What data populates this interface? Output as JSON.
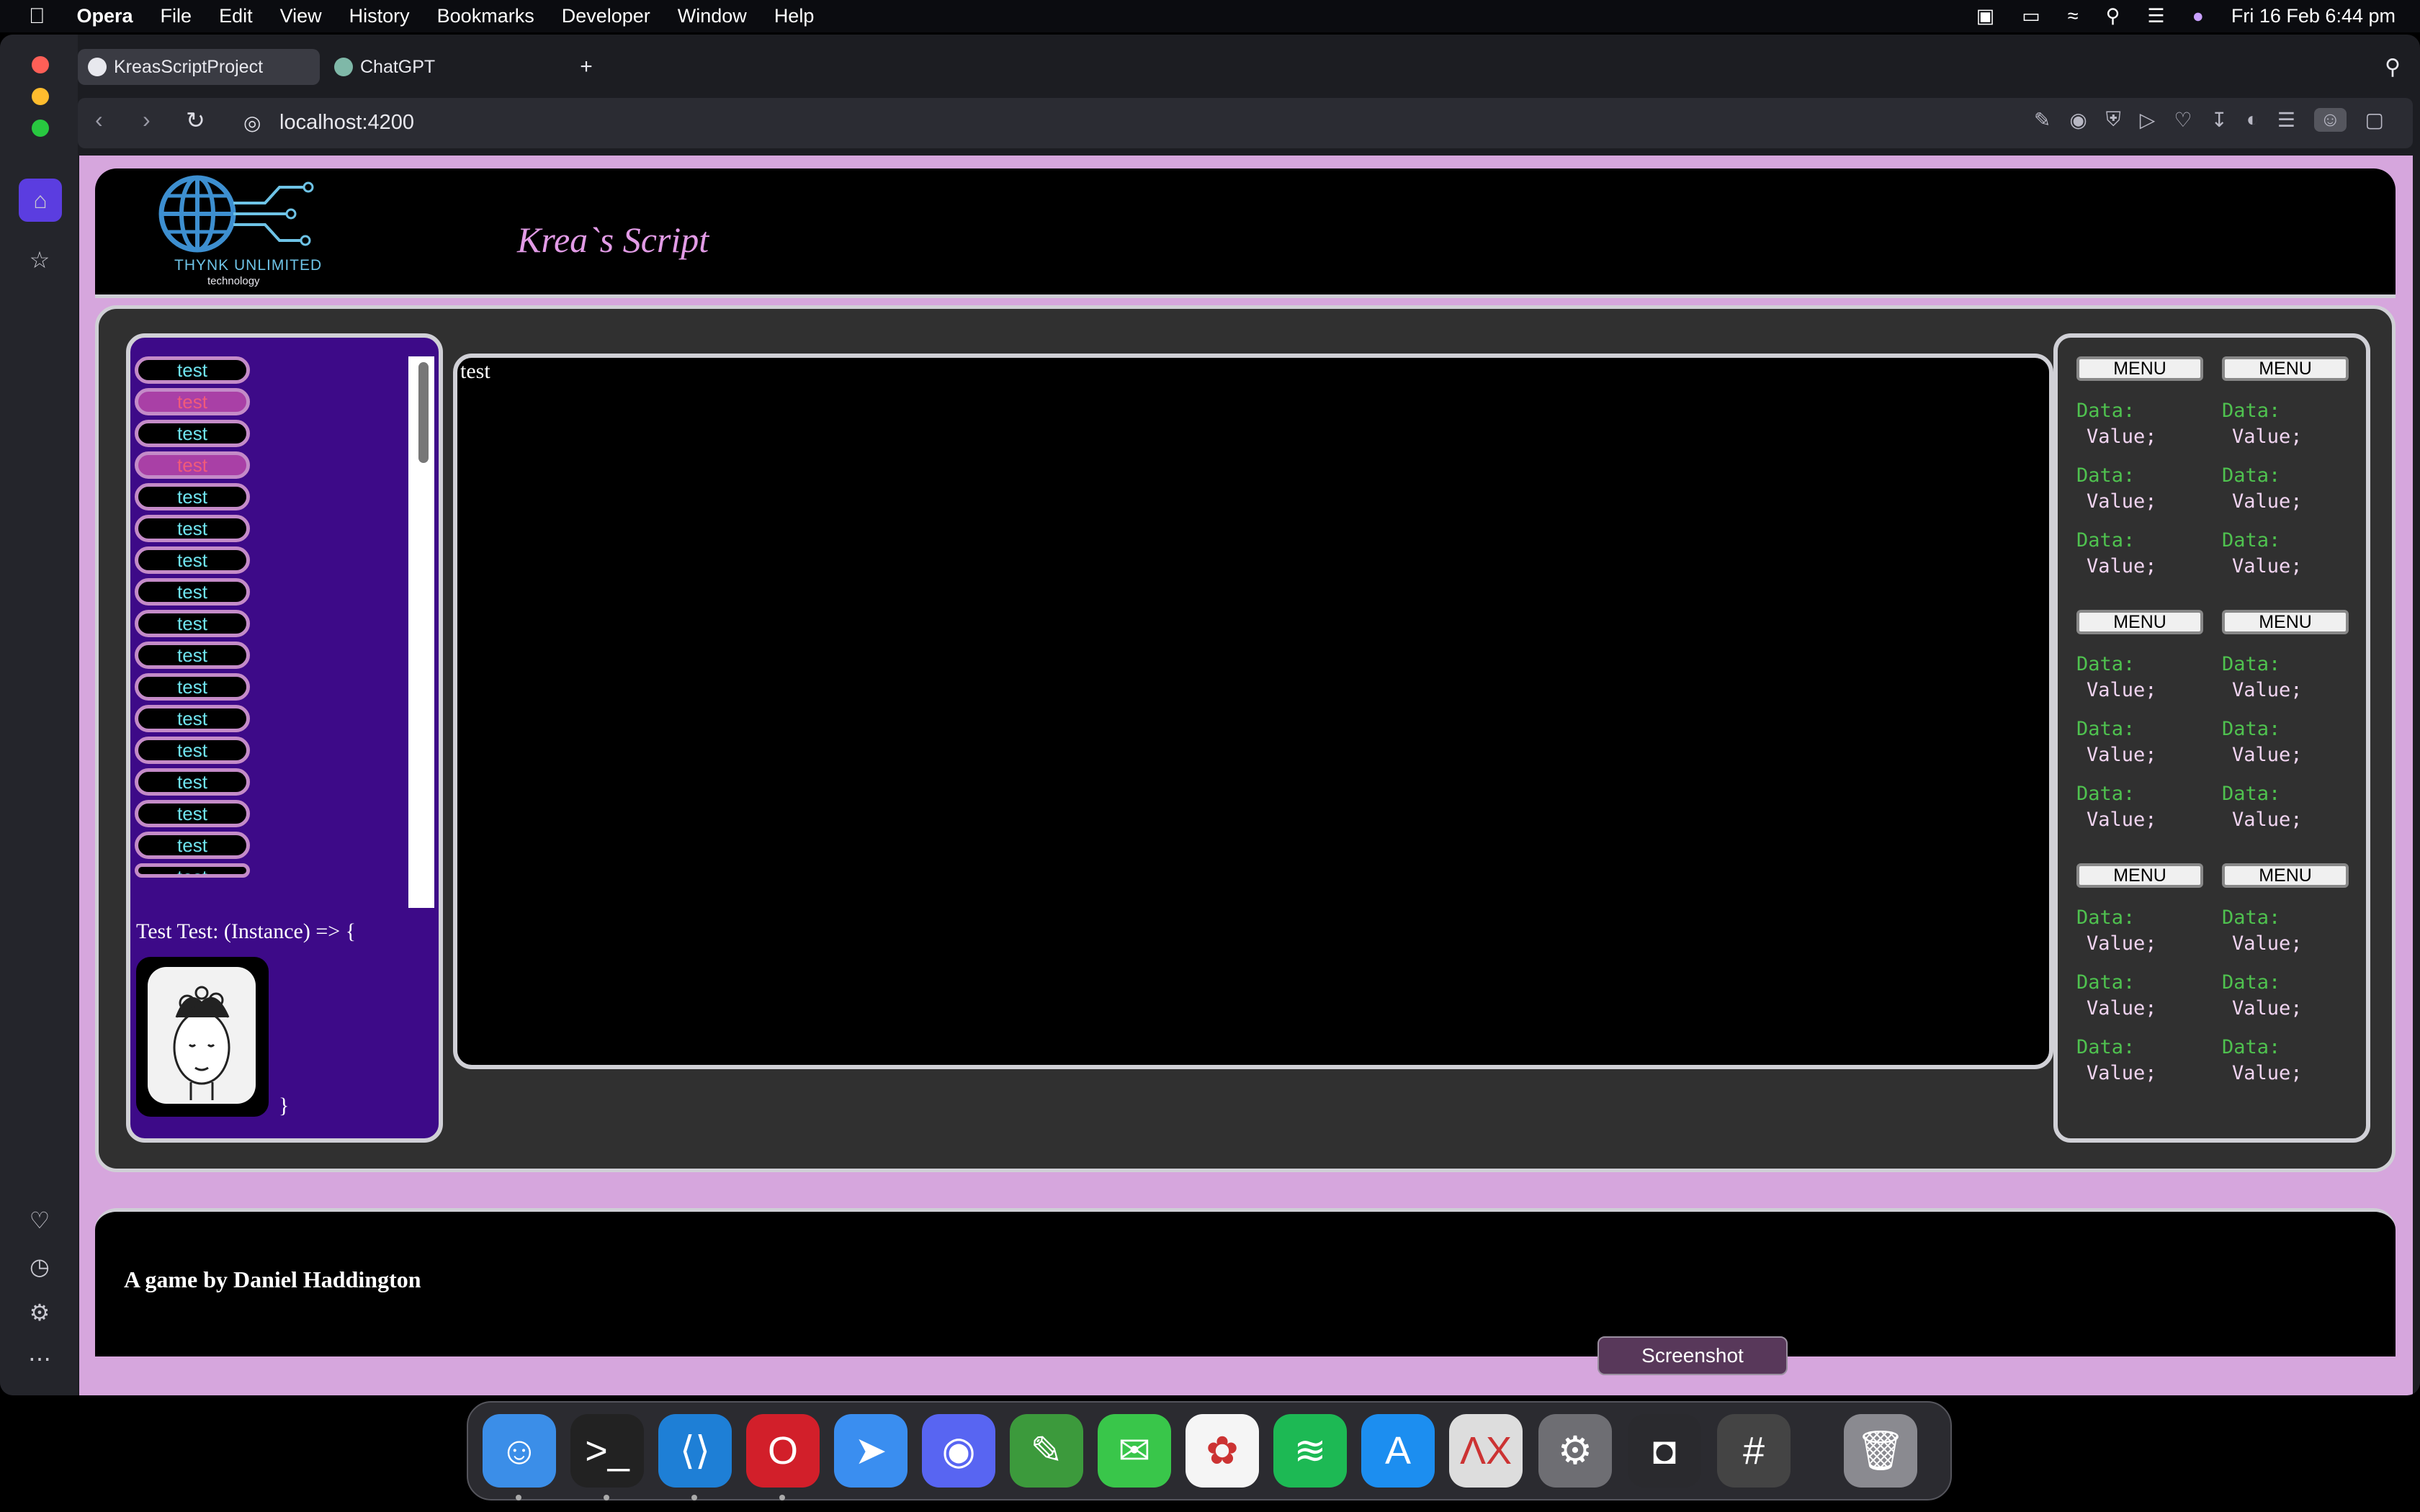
{
  "menubar": {
    "app": "Opera",
    "items": [
      "File",
      "Edit",
      "View",
      "History",
      "Bookmarks",
      "Developer",
      "Window",
      "Help"
    ],
    "datetime": "Fri 16 Feb  6:44 pm"
  },
  "tabs": [
    {
      "label": "KreasScriptProject"
    },
    {
      "label": "ChatGPT"
    }
  ],
  "address": {
    "url": "localhost:4200"
  },
  "page": {
    "logo_text": "THYNK UNLIMITED",
    "logo_sub": "technology",
    "title": "Krea`s Script",
    "list_items": [
      {
        "label": "test",
        "selected": false
      },
      {
        "label": "test",
        "selected": true
      },
      {
        "label": "test",
        "selected": false
      },
      {
        "label": "test",
        "selected": true
      },
      {
        "label": "test",
        "selected": false
      },
      {
        "label": "test",
        "selected": false
      },
      {
        "label": "test",
        "selected": false
      },
      {
        "label": "test",
        "selected": false
      },
      {
        "label": "test",
        "selected": false
      },
      {
        "label": "test",
        "selected": false
      },
      {
        "label": "test",
        "selected": false
      },
      {
        "label": "test",
        "selected": false
      },
      {
        "label": "test",
        "selected": false
      },
      {
        "label": "test",
        "selected": false
      },
      {
        "label": "test",
        "selected": false
      },
      {
        "label": "test",
        "selected": false
      },
      {
        "label": "test",
        "selected": false
      }
    ],
    "instance_text": "Test Test: (Instance) => {",
    "close_brace": "}",
    "screen_text": "test",
    "menu_label": "MENU",
    "data_label": "Data:",
    "value_label": "Value;",
    "footer": "A game by Daniel Haddington"
  },
  "dock": {
    "tooltip": "Screenshot",
    "apps": [
      "finder-icon",
      "terminal-icon",
      "vscode-icon",
      "opera-icon",
      "spark-icon",
      "discord-icon",
      "evernote-icon",
      "messages-icon",
      "photos-icon",
      "spotify-icon",
      "app-store-icon",
      "latexit-icon",
      "system-settings-icon",
      "screenshot-icon",
      "calculator-icon",
      "trash-icon"
    ]
  }
}
